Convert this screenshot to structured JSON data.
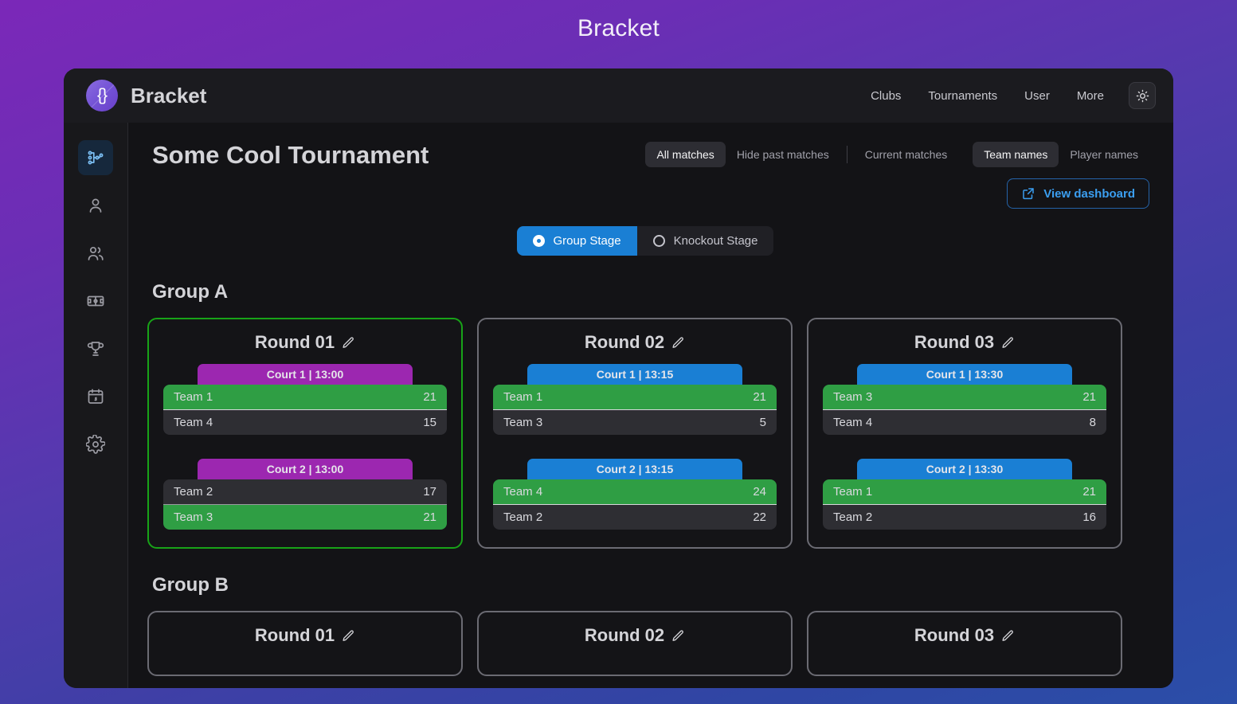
{
  "page": {
    "heading": "Bracket"
  },
  "topbar": {
    "logo_glyph": "{}",
    "brand": "Bracket",
    "nav": [
      {
        "label": "Clubs"
      },
      {
        "label": "Tournaments"
      },
      {
        "label": "User"
      },
      {
        "label": "More"
      }
    ],
    "theme_toggle_icon": "sun-icon"
  },
  "sidebar": {
    "items": [
      {
        "name": "bracket",
        "icon": "bracket-icon",
        "active": true
      },
      {
        "name": "user",
        "icon": "user-icon",
        "active": false
      },
      {
        "name": "players",
        "icon": "users-icon",
        "active": false
      },
      {
        "name": "courts",
        "icon": "court-icon",
        "active": false
      },
      {
        "name": "tournaments",
        "icon": "trophy-icon",
        "active": false
      },
      {
        "name": "schedule",
        "icon": "calendar-icon",
        "active": false
      },
      {
        "name": "settings",
        "icon": "gear-icon",
        "active": false
      }
    ]
  },
  "header": {
    "title": "Some Cool Tournament",
    "match_filters": [
      {
        "label": "All matches",
        "active": true
      },
      {
        "label": "Hide past matches",
        "active": false
      },
      {
        "label": "Current matches",
        "active": false
      }
    ],
    "name_filters": [
      {
        "label": "Team names",
        "active": true
      },
      {
        "label": "Player names",
        "active": false
      }
    ],
    "dashboard_button": {
      "label": "View dashboard",
      "icon": "external-link-icon",
      "color": "#3b9ef0"
    }
  },
  "stage_toggle": [
    {
      "label": "Group Stage",
      "active": true
    },
    {
      "label": "Knockout Stage",
      "active": false
    }
  ],
  "colors": {
    "accent_blue": "#1a7fd4",
    "court_purple": "#9c27b0",
    "winner_green": "#2f9e44",
    "highlight_border": "#18a318",
    "card_border": "#6b6b73"
  },
  "groups": [
    {
      "label": "Group A",
      "rounds": [
        {
          "title": "Round 01",
          "edit_icon": "pencil-icon",
          "highlighted": true,
          "matches": [
            {
              "court_label": "Court 1 | 13:00",
              "court_color": "purple",
              "teams": [
                {
                  "name": "Team 1",
                  "score": "21",
                  "winner": true
                },
                {
                  "name": "Team 4",
                  "score": "15",
                  "winner": false
                }
              ]
            },
            {
              "court_label": "Court 2 | 13:00",
              "court_color": "purple",
              "teams": [
                {
                  "name": "Team 2",
                  "score": "17",
                  "winner": false
                },
                {
                  "name": "Team 3",
                  "score": "21",
                  "winner": true
                }
              ]
            }
          ]
        },
        {
          "title": "Round 02",
          "edit_icon": "pencil-icon",
          "highlighted": false,
          "matches": [
            {
              "court_label": "Court 1 | 13:15",
              "court_color": "blue",
              "teams": [
                {
                  "name": "Team 1",
                  "score": "21",
                  "winner": true
                },
                {
                  "name": "Team 3",
                  "score": "5",
                  "winner": false
                }
              ]
            },
            {
              "court_label": "Court 2 | 13:15",
              "court_color": "blue",
              "teams": [
                {
                  "name": "Team 4",
                  "score": "24",
                  "winner": true
                },
                {
                  "name": "Team 2",
                  "score": "22",
                  "winner": false
                }
              ]
            }
          ]
        },
        {
          "title": "Round 03",
          "edit_icon": "pencil-icon",
          "highlighted": false,
          "matches": [
            {
              "court_label": "Court 1 | 13:30",
              "court_color": "blue",
              "teams": [
                {
                  "name": "Team 3",
                  "score": "21",
                  "winner": true
                },
                {
                  "name": "Team 4",
                  "score": "8",
                  "winner": false
                }
              ]
            },
            {
              "court_label": "Court 2 | 13:30",
              "court_color": "blue",
              "teams": [
                {
                  "name": "Team 1",
                  "score": "21",
                  "winner": true
                },
                {
                  "name": "Team 2",
                  "score": "16",
                  "winner": false
                }
              ]
            }
          ]
        }
      ]
    },
    {
      "label": "Group B",
      "rounds": [
        {
          "title": "Round 01",
          "edit_icon": "pencil-icon",
          "highlighted": false,
          "matches": []
        },
        {
          "title": "Round 02",
          "edit_icon": "pencil-icon",
          "highlighted": false,
          "matches": []
        },
        {
          "title": "Round 03",
          "edit_icon": "pencil-icon",
          "highlighted": false,
          "matches": []
        }
      ]
    }
  ]
}
